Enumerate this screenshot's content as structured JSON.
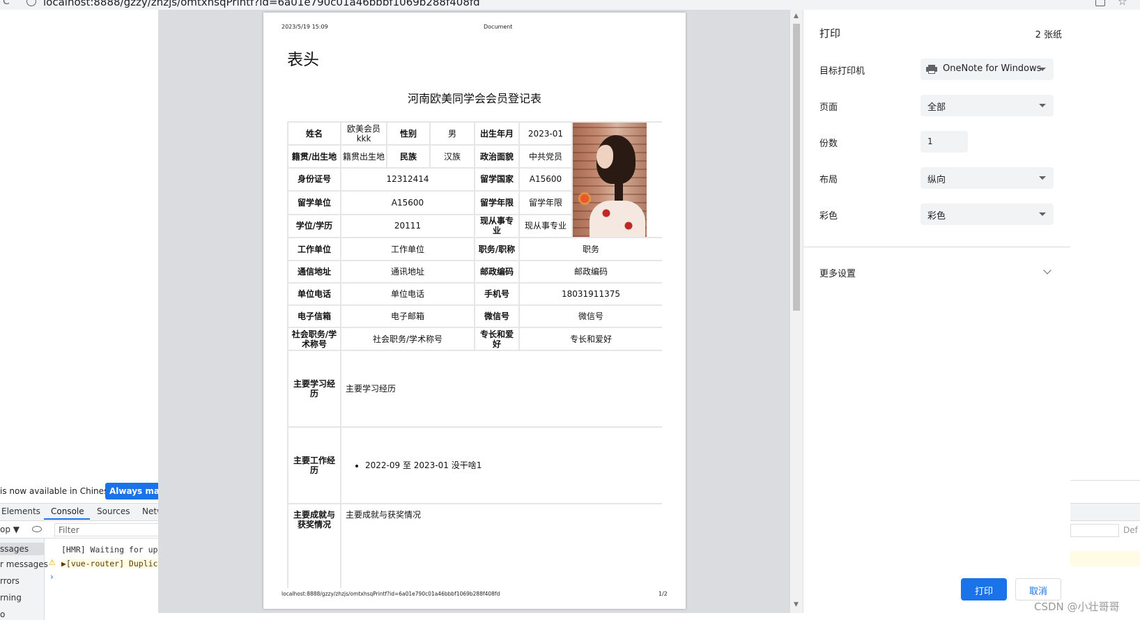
{
  "browser": {
    "url": "localhost:8888/gzzy/zhzjs/omtxhsqPrintf?id=6a01e790c01a46bbbf1069b288f408fd"
  },
  "background_page": {
    "lang_banner_text": "is now available in Chinese!",
    "lang_banner_button": "Always match",
    "devtools_tabs": [
      "Elements",
      "Console",
      "Sources",
      "Netw"
    ],
    "filter_top": "op ▼",
    "filter_placeholder": "Filter",
    "sidebar_items": [
      "ssages",
      "r messages",
      "rrors",
      "rning",
      "o"
    ],
    "console_lines": [
      "[HMR] Waiting for upd",
      "▶[vue-router] Duplica"
    ],
    "right_default_label": "Def"
  },
  "print_preview": {
    "header_date": "2023/5/19 15:09",
    "header_title": "Document",
    "page_heading": "表头",
    "form_title": "河南欧美同学会会员登记表",
    "footer_url": "localhost:8888/gzzy/zhzjs/omtxhsqPrintf?id=6a01e790c01a46bbbf1069b288f408fd",
    "footer_page": "1/2",
    "form": {
      "name_label": "姓名",
      "name_value": "欧美会员kkk",
      "gender_label": "性别",
      "gender_value": "男",
      "birth_label": "出生年月",
      "birth_value": "2023-01",
      "origin_label": "籍贯/出生地",
      "origin_value": "籍贯出生地",
      "ethnic_label": "民族",
      "ethnic_value": "汉族",
      "political_label": "政治面貌",
      "political_value": "中共党员",
      "id_label": "身份证号",
      "id_value": "12312414",
      "study_country_label": "留学国家",
      "study_country_value": "A15600",
      "study_unit_label": "留学单位",
      "study_unit_value": "A15600",
      "study_years_label": "留学年限",
      "study_years_value": "留学年限",
      "degree_label": "学位/学历",
      "degree_value": "20111",
      "major_label": "现从事专业",
      "major_value": "现从事专业",
      "work_unit_label": "工作单位",
      "work_unit_value": "工作单位",
      "position_label": "职务/职称",
      "position_value": "职务",
      "address_label": "通信地址",
      "address_value": "通讯地址",
      "postcode_label": "邮政编码",
      "postcode_value": "邮政编码",
      "unit_phone_label": "单位电话",
      "unit_phone_value": "单位电话",
      "mobile_label": "手机号",
      "mobile_value": "18031911375",
      "email_label": "电子信箱",
      "email_value": "电子邮箱",
      "wechat_label": "微信号",
      "wechat_value": "微信号",
      "social_label": "社会职务/学术称号",
      "social_value": "社会职务/学术称号",
      "hobby_label": "专长和爱好",
      "hobby_value": "专长和爱好",
      "study_exp_label": "主要学习经历",
      "study_exp_value": "主要学习经历",
      "work_exp_label": "主要工作经历",
      "work_exp_items": [
        "2022-09 至 2023-01 没干啥1"
      ],
      "awards_label": "主要成就与获奖情况",
      "awards_value": "主要成就与获奖情况"
    }
  },
  "print_settings": {
    "title": "打印",
    "sheets": "2 张纸",
    "destination_label": "目标打印机",
    "destination_value": "OneNote for Windows",
    "pages_label": "页面",
    "pages_value": "全部",
    "copies_label": "份数",
    "copies_value": "1",
    "layout_label": "布局",
    "layout_value": "纵向",
    "color_label": "彩色",
    "color_value": "彩色",
    "more_settings": "更多设置",
    "print_button": "打印",
    "cancel_button": "取消"
  },
  "watermark": "CSDN @小壮哥哥"
}
